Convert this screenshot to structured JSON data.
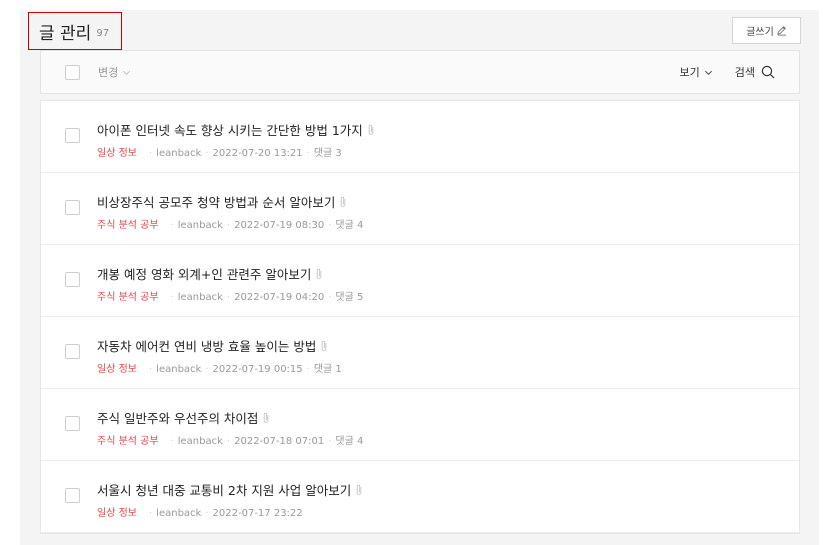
{
  "header": {
    "title": "글 관리",
    "count": "97",
    "write_label": "글쓰기"
  },
  "toolbar": {
    "change_label": "변경",
    "view_label": "보기",
    "search_label": "검색"
  },
  "posts": [
    {
      "title": "아이폰 인터넷 속도 향상 시키는 간단한 방법 1가지",
      "category": "일상 정보",
      "author": "leanback",
      "date": "2022-07-20 13:21",
      "comments": "댓글 3"
    },
    {
      "title": "비상장주식 공모주 청약 방법과 순서 알아보기",
      "category": "주식 분석 공부",
      "author": "leanback",
      "date": "2022-07-19 08:30",
      "comments": "댓글 4"
    },
    {
      "title": "개봉 예정 영화 외계+인 관련주 알아보기",
      "category": "주식 분석 공부",
      "author": "leanback",
      "date": "2022-07-19 04:20",
      "comments": "댓글 5"
    },
    {
      "title": "자동차 에어컨 연비 냉방 효율 높이는 방법",
      "category": "일상 정보",
      "author": "leanback",
      "date": "2022-07-19 00:15",
      "comments": "댓글 1"
    },
    {
      "title": "주식 일반주와 우선주의 차이점",
      "category": "주식 분석 공부",
      "author": "leanback",
      "date": "2022-07-18 07:01",
      "comments": "댓글 4"
    },
    {
      "title": "서울시 청년 대중 교통비 2차 지원 사업 알아보기",
      "category": "일상 정보",
      "author": "leanback",
      "date": "2022-07-17 23:22",
      "comments": ""
    }
  ],
  "icons": {
    "write": "pencil-icon",
    "search": "search-icon",
    "attachment": "paperclip-icon",
    "dropdown": "chevron-down-icon"
  },
  "colors": {
    "category": "#e0484b",
    "highlight_box": "#cc0000"
  }
}
